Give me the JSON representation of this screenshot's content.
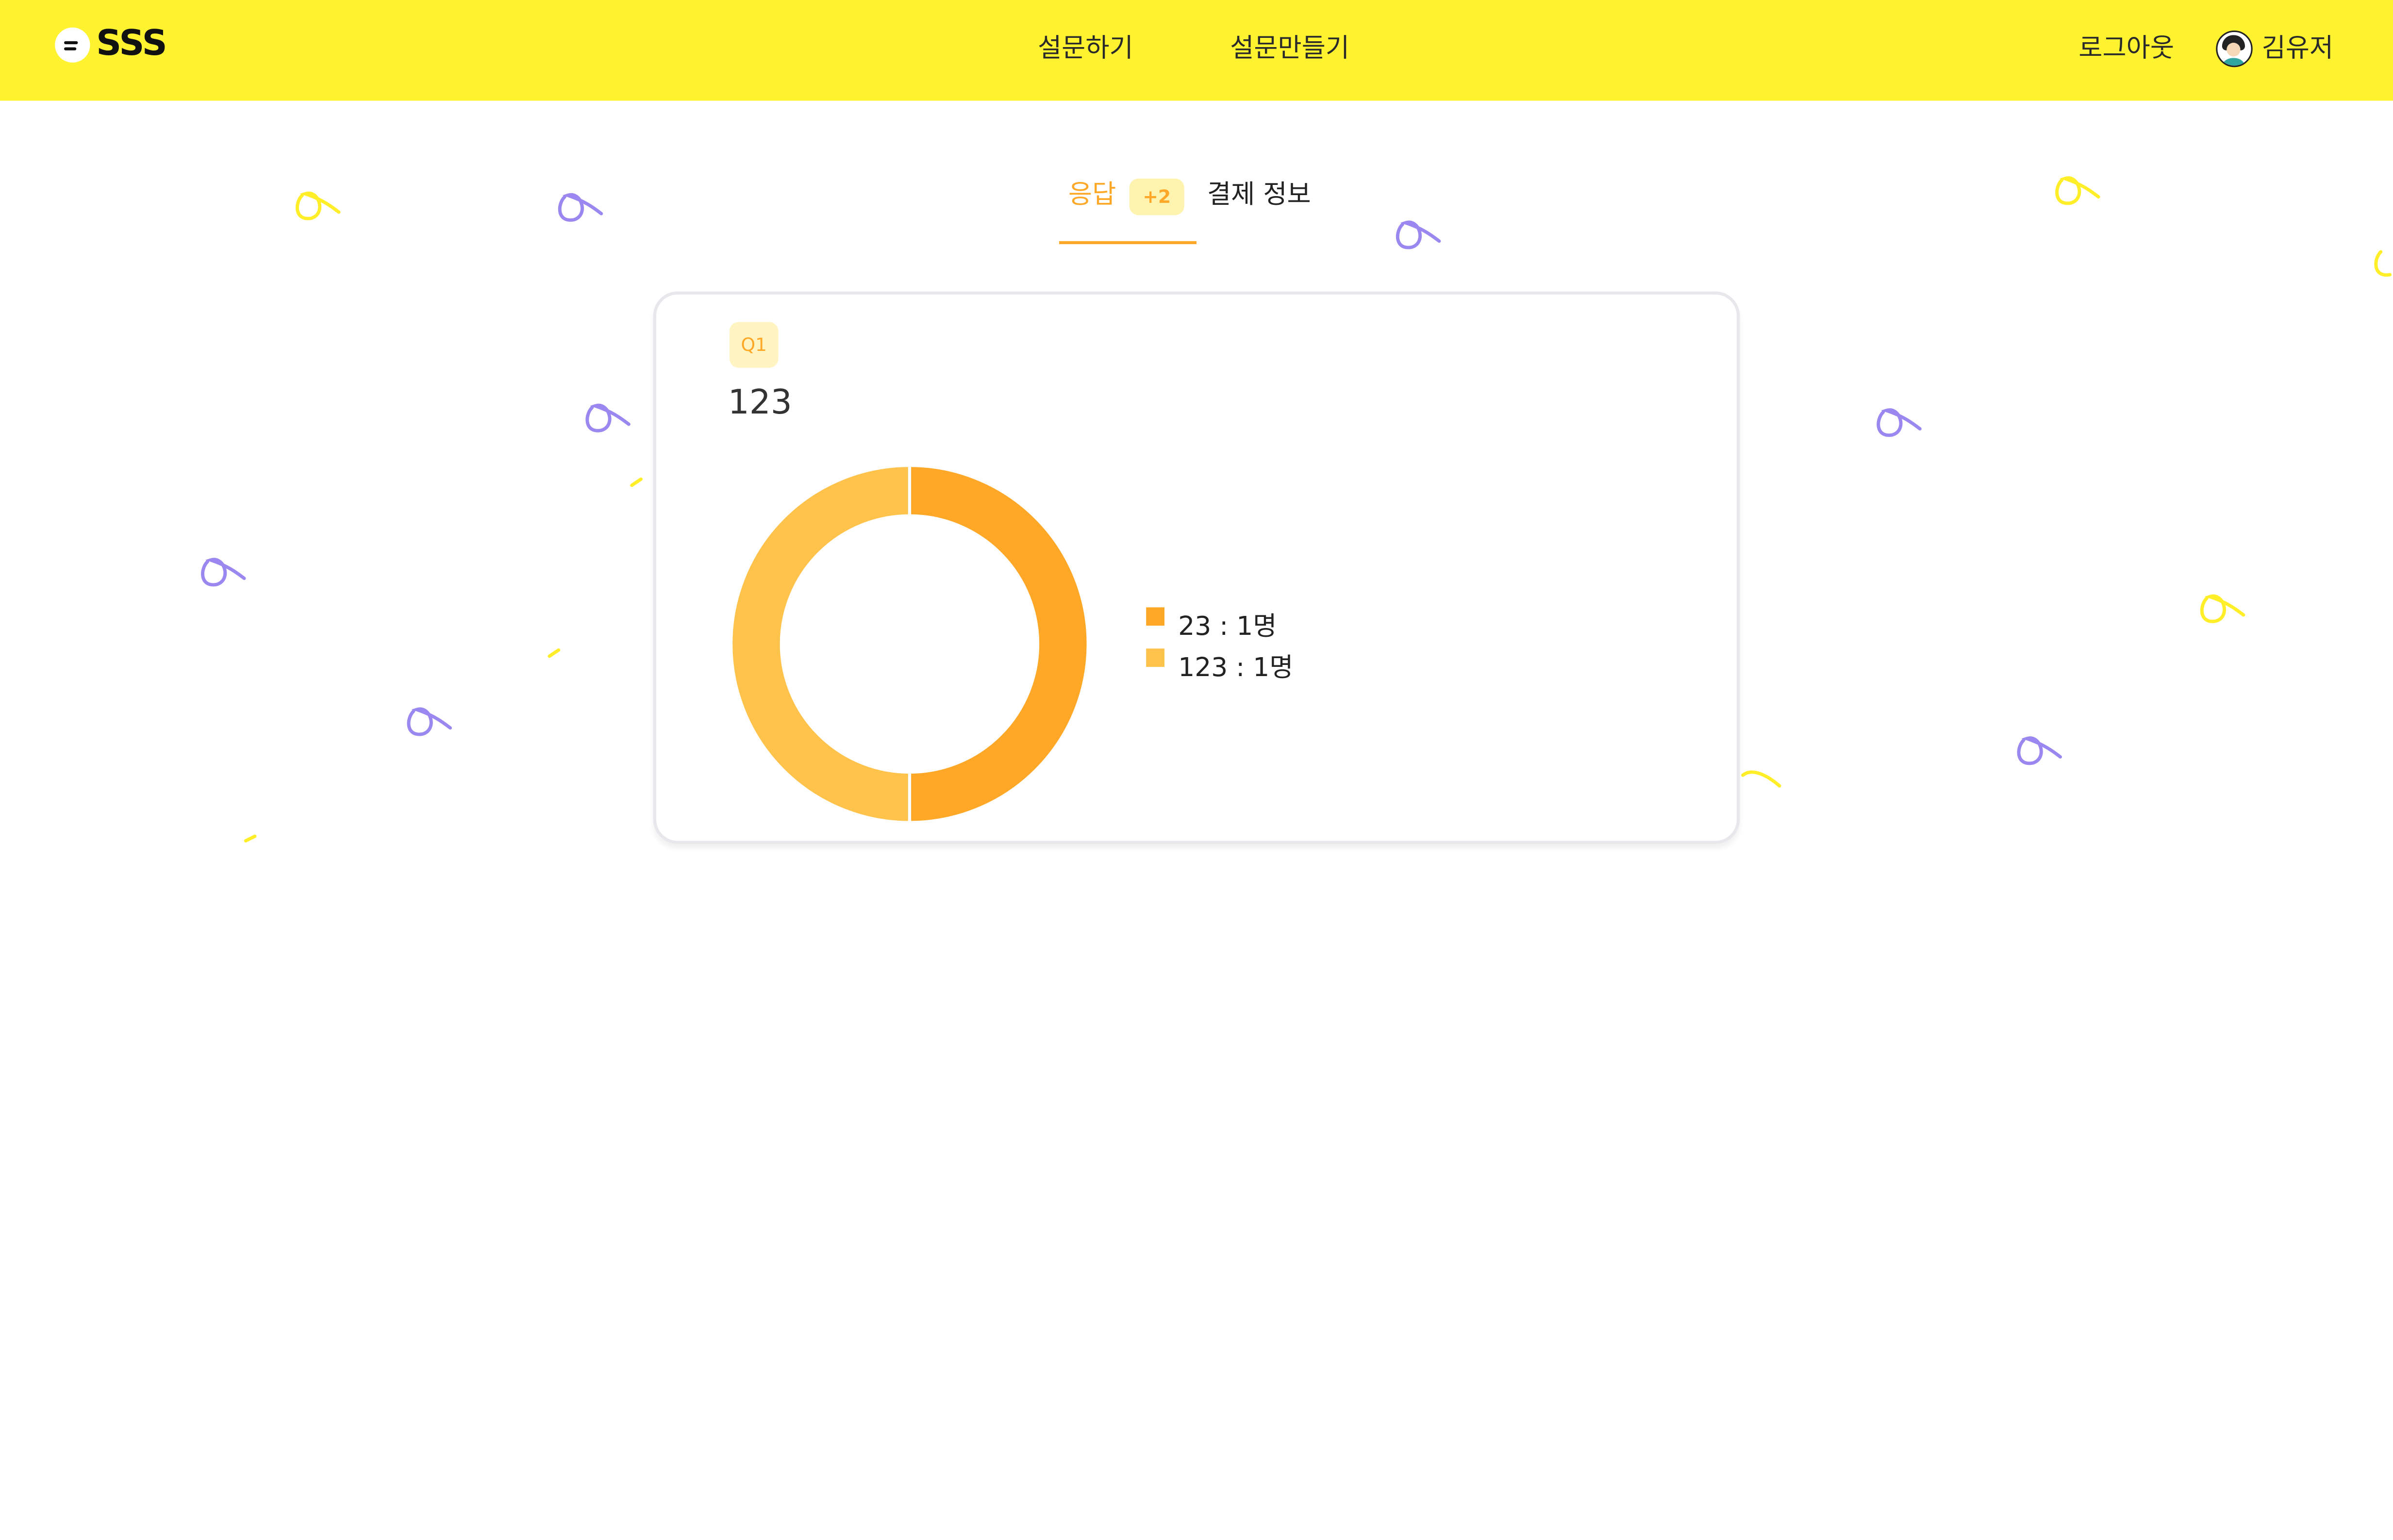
{
  "header": {
    "logo_text": "SSS",
    "nav": {
      "take_survey": "설문하기",
      "make_survey": "설문만들기"
    },
    "logout": "로그아웃",
    "user_name": "김유저"
  },
  "tabs": {
    "response_label": "응답",
    "response_badge": "+2",
    "payment_label": "결제 정보"
  },
  "question": {
    "number_label": "Q1",
    "title": "123"
  },
  "chart_data": {
    "type": "pie",
    "title": "123",
    "categories": [
      "23",
      "123"
    ],
    "values": [
      1,
      1
    ],
    "legend": [
      "23 : 1명",
      "123 : 1명"
    ],
    "colors": [
      "#ffa726",
      "#ffc24a"
    ],
    "legend_position": "right",
    "donut": true
  },
  "colors": {
    "brand_yellow": "#fff22e",
    "accent_orange": "#ffa726",
    "confetti_yellow": "#ffee28",
    "confetti_purple": "#9a88f0"
  }
}
